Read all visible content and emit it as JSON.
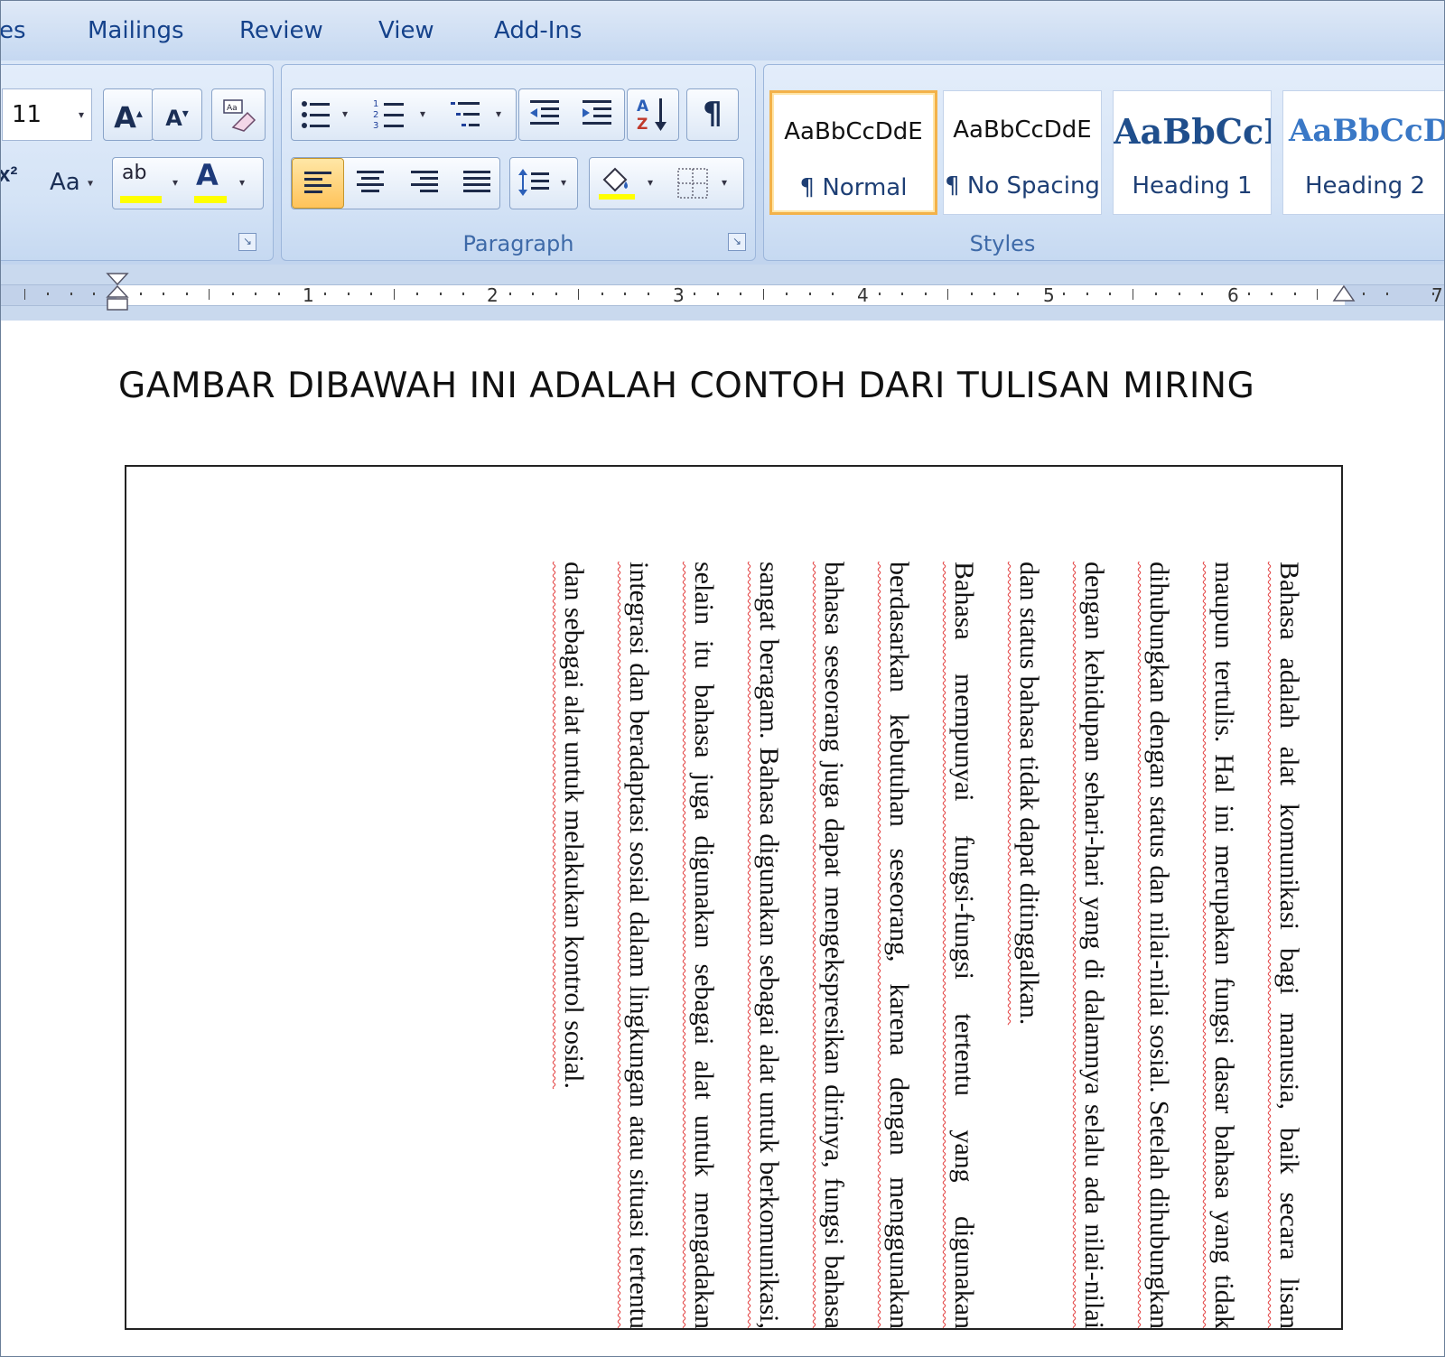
{
  "tabs": [
    "es",
    "Mailings",
    "Review",
    "View",
    "Add-Ins"
  ],
  "font_group": {
    "font_size": "11",
    "grow_font": "A",
    "shrink_font": "A",
    "change_case": "Aa",
    "superscript": "x²",
    "font_color": "A",
    "highlight": "ab"
  },
  "paragraph_group": {
    "label": "Paragraph",
    "sort_icon": "A Z",
    "show_marks": "¶"
  },
  "styles_group": {
    "label": "Styles",
    "tiles": [
      {
        "sample": "AaBbCcDdE",
        "name": "¶ Normal"
      },
      {
        "sample": "AaBbCcDdE",
        "name": "¶ No Spacing"
      },
      {
        "sample": "AaBbCcI",
        "name": "Heading 1"
      },
      {
        "sample": "AaBbCcD",
        "name": "Heading 2"
      }
    ]
  },
  "ruler": {
    "numbers": [
      "1",
      "2",
      "3",
      "4",
      "5",
      "6",
      "7"
    ]
  },
  "document": {
    "heading": "GAMBAR DIBAWAH INI ADALAH CONTOH DARI TULISAN MIRING",
    "paragraph1": "Bahasa adalah alat komunikasi bagi manusia, baik secara lisan maupun tertulis. Hal ini merupakan fungsi dasar bahasa yang tidak dihubungkan dengan status dan nilai-nilai sosial. Setelah dihubungkan dengan kehidupan sehari-hari yang di dalamnya selalu ada nilai-nilai dan status bahasa tidak dapat ditinggalkan.",
    "paragraph2": "Bahasa mempunyai fungsi-fungsi tertentu yang digunakan berdasarkan kebutuhan seseorang, karena dengan menggunakan bahasa seseorang juga dapat mengekspresikan dirinya, fungsi bahasa sangat beragam. Bahasa digunakan sebagai alat untuk berkomunikasi, selain itu bahasa juga digunakan sebagai alat untuk mengadakan integrasi dan beradaptasi sosial dalam lingkungan atau situasi tertentu dan sebagai alat untuk melakukan kontrol sosial."
  }
}
